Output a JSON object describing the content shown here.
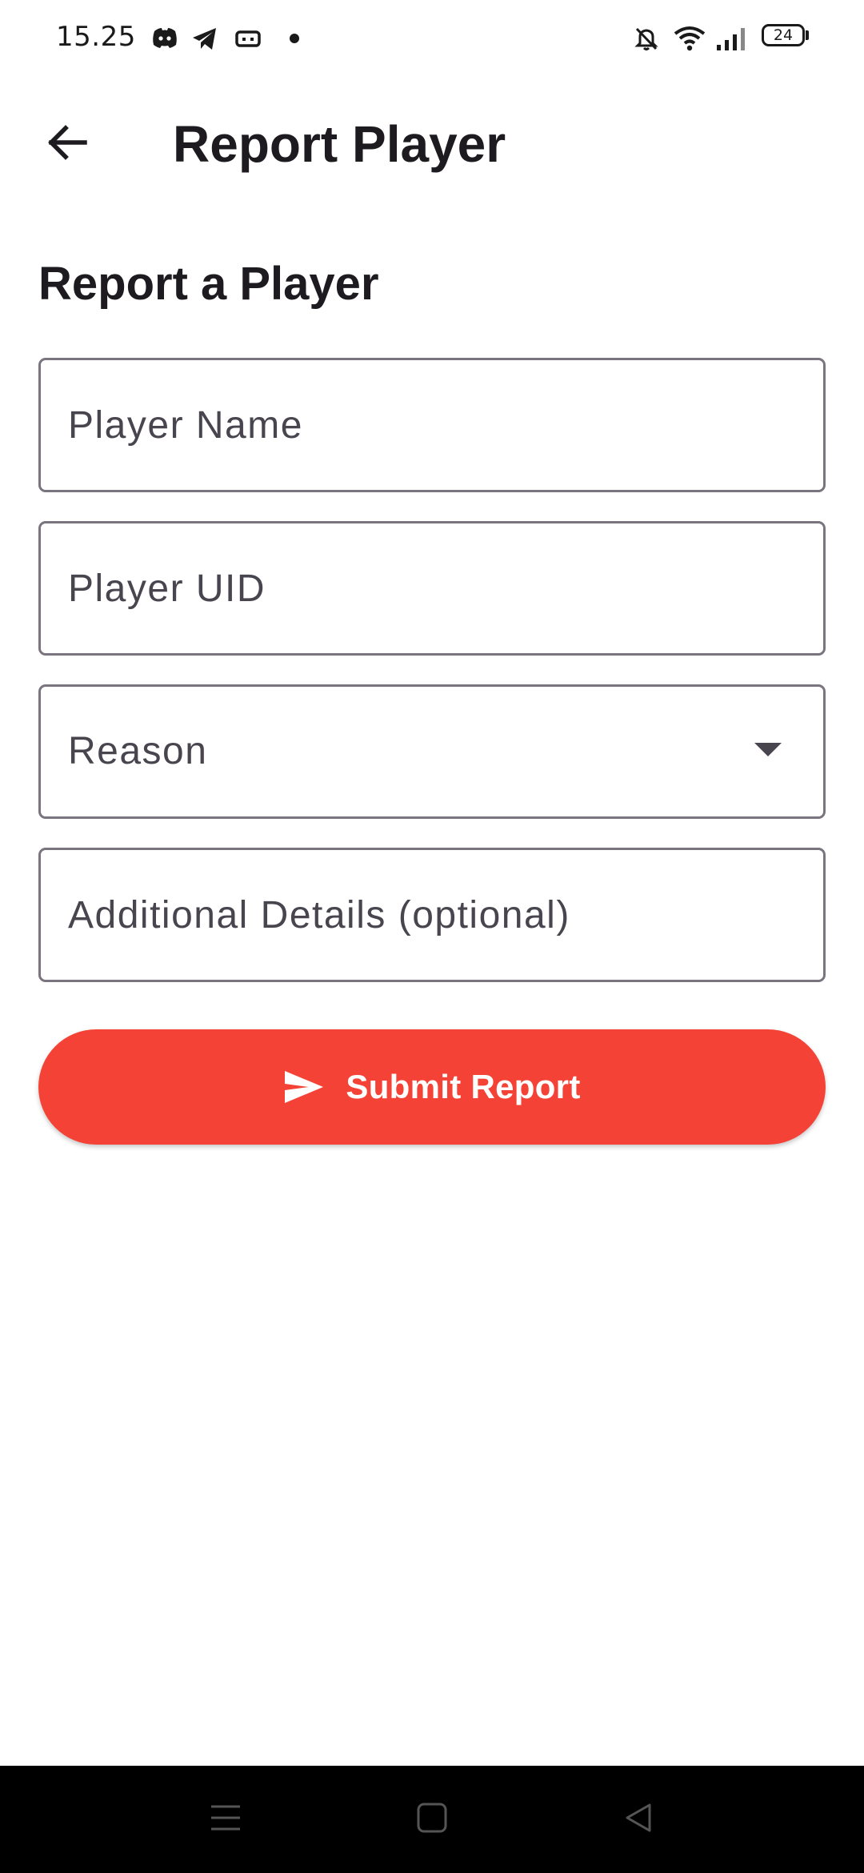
{
  "status_bar": {
    "time": "15.25",
    "battery_level": "24",
    "notification_icons": [
      "discord-icon",
      "telegram-icon",
      "gamepad-icon",
      "dot-icon"
    ],
    "system_icons": [
      "bell-off-icon",
      "wifi-icon",
      "signal-icon",
      "battery-icon"
    ]
  },
  "app_bar": {
    "title": "Report Player",
    "back_icon": "arrow-back-icon"
  },
  "form": {
    "heading": "Report a Player",
    "player_name": {
      "placeholder": "Player Name",
      "value": ""
    },
    "player_uid": {
      "placeholder": "Player UID",
      "value": ""
    },
    "reason": {
      "label": "Reason",
      "icon": "dropdown-caret-icon"
    },
    "details": {
      "placeholder": "Additional Details (optional)",
      "value": ""
    },
    "submit": {
      "label": "Submit Report",
      "icon": "send-icon"
    }
  },
  "colors": {
    "accent": "#f44336",
    "text": "#1d1b20",
    "hint": "#49454f",
    "outline": "#79747e"
  },
  "nav_bar": {
    "buttons": [
      "menu-icon",
      "home-icon",
      "back-triangle-icon"
    ]
  }
}
